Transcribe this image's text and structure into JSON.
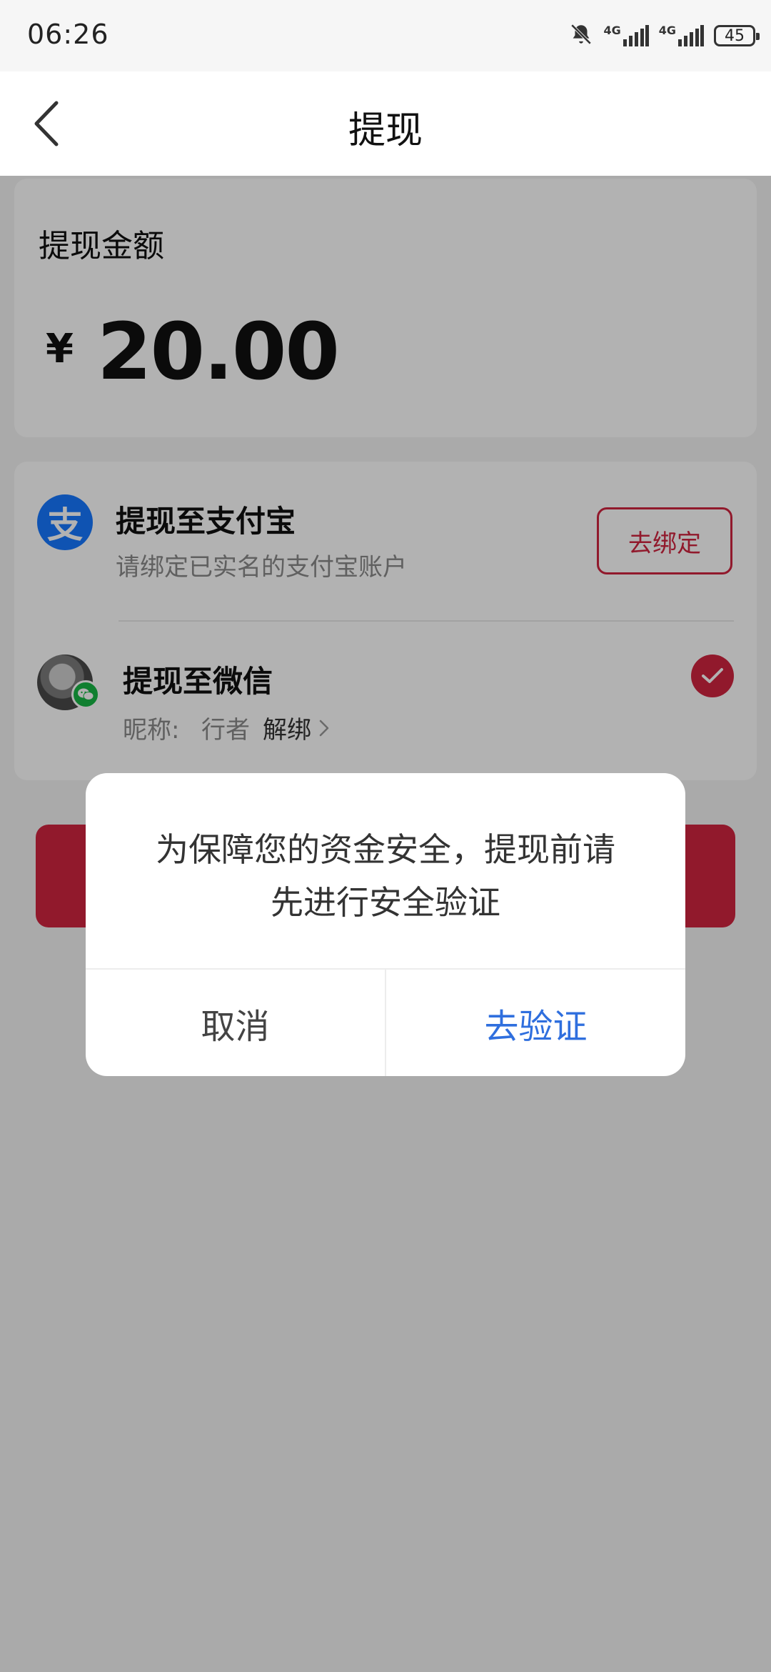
{
  "status_bar": {
    "time": "06:26",
    "signal_1": "4G",
    "signal_2": "4G",
    "battery": "45"
  },
  "header": {
    "title": "提现"
  },
  "amount_card": {
    "label": "提现金额",
    "currency_symbol": "¥",
    "amount": "20.00"
  },
  "methods": {
    "alipay": {
      "title": "提现至支付宝",
      "subtitle": "请绑定已实名的支付宝账户",
      "button": "去绑定",
      "logo_glyph": "支"
    },
    "wechat": {
      "title": "提现至微信",
      "nickname_label": "昵称:",
      "nickname_value": "行者",
      "unbind": "解绑"
    }
  },
  "modal": {
    "message_line1": "为保障您的资金安全，提现前请",
    "message_line2": "先进行安全验证",
    "cancel": "取消",
    "confirm": "去验证"
  },
  "colors": {
    "accent_red": "#d0253f",
    "confirm_blue": "#2f6fde",
    "alipay_blue": "#1677ff",
    "wechat_green": "#18b745"
  }
}
